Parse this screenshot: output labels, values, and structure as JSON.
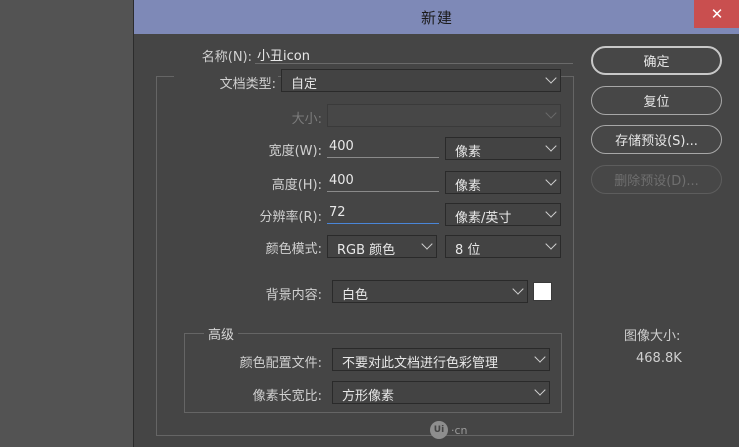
{
  "window": {
    "title": "新建",
    "close_glyph": "✕"
  },
  "fields": {
    "name_label": "名称(N):",
    "name_value": "小丑icon",
    "doc_type_label": "文档类型:",
    "doc_type_value": "自定",
    "size_label": "大小:",
    "size_value": "",
    "width_label": "宽度(W):",
    "width_value": "400",
    "width_unit": "像素",
    "height_label": "高度(H):",
    "height_value": "400",
    "height_unit": "像素",
    "resolution_label": "分辨率(R):",
    "resolution_value": "72",
    "resolution_unit": "像素/英寸",
    "color_mode_label": "颜色模式:",
    "color_mode_value": "RGB 颜色",
    "bit_depth_value": "8 位",
    "background_label": "背景内容:",
    "background_value": "白色",
    "background_swatch_color": "#ffffff"
  },
  "advanced": {
    "title": "高级",
    "profile_label": "颜色配置文件:",
    "profile_value": "不要对此文档进行色彩管理",
    "aspect_label": "像素长宽比:",
    "aspect_value": "方形像素"
  },
  "buttons": {
    "ok": "确定",
    "reset": "复位",
    "save_preset": "存储预设(S)...",
    "delete_preset": "删除预设(D)..."
  },
  "image_size": {
    "label": "图像大小:",
    "value": "468.8K"
  },
  "watermark": {
    "logo": "Ui",
    "text": "·cn"
  },
  "colors": {
    "titlebar": "#7e89b7",
    "close": "#c94f4f",
    "focus": "#4a86d8"
  }
}
